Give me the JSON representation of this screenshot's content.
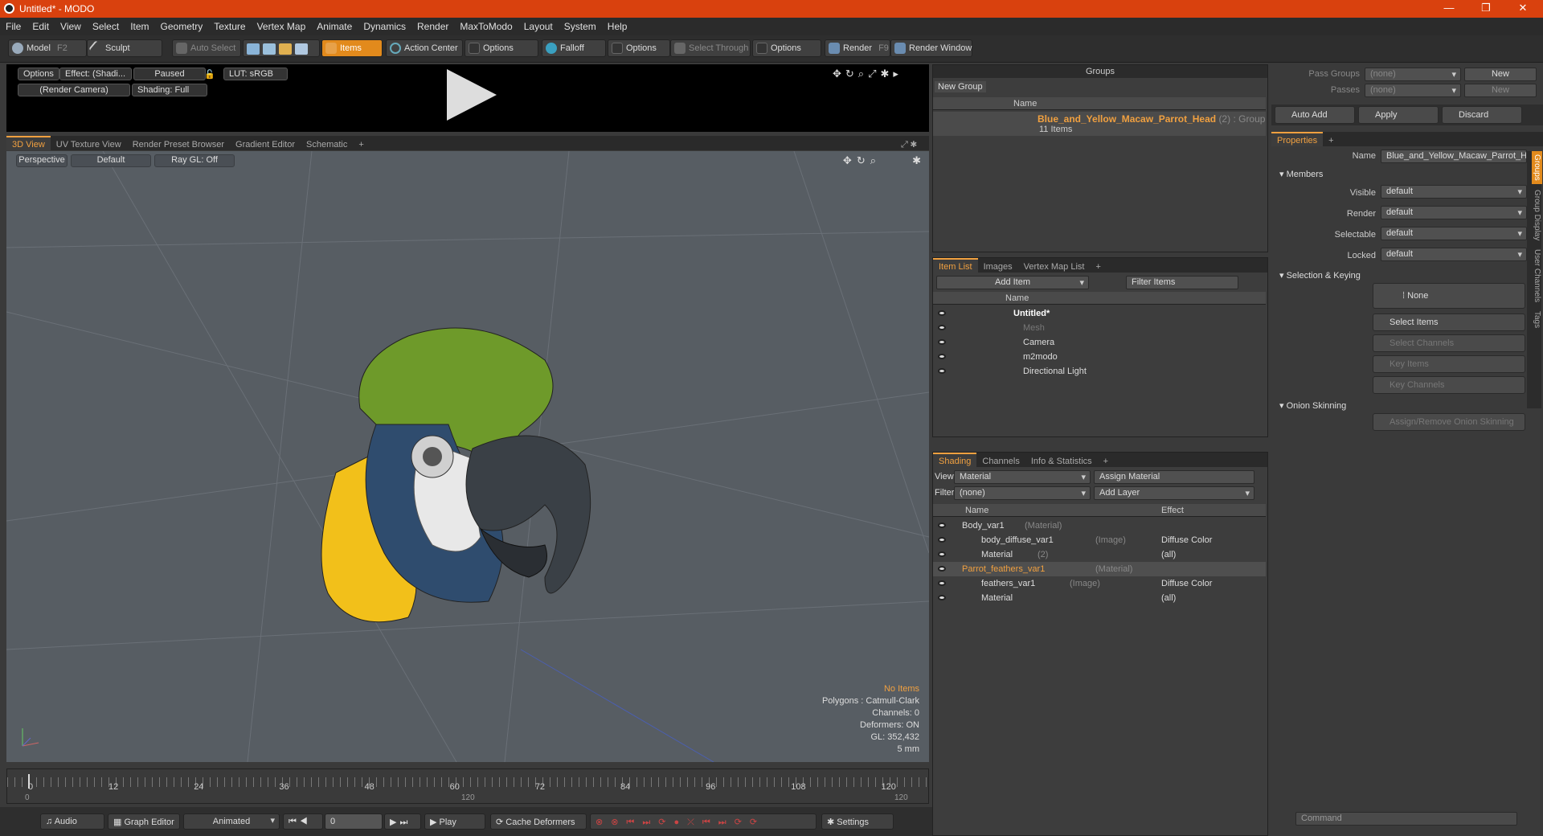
{
  "window": {
    "title": "Untitled* - MODO",
    "controls": [
      "—",
      "❐",
      "✕"
    ]
  },
  "menu": [
    "File",
    "Edit",
    "View",
    "Select",
    "Item",
    "Geometry",
    "Texture",
    "Vertex Map",
    "Animate",
    "Dynamics",
    "Render",
    "MaxToModo",
    "Layout",
    "System",
    "Help"
  ],
  "toolbar": {
    "model": "Model",
    "model_key": "F2",
    "sculpt": "Sculpt",
    "auto_select": "Auto Select",
    "items": "Items",
    "action_center": "Action Center",
    "options1": "Options",
    "falloff": "Falloff",
    "options2": "Options",
    "select_through": "Select Through",
    "options3": "Options",
    "render": "Render",
    "render_key": "F9",
    "render_window": "Render Window"
  },
  "preview": {
    "options": "Options",
    "effect": "Effect: (Shadi...",
    "paused": "Paused",
    "lut": "LUT: sRGB",
    "camera": "(Render Camera)",
    "shading": "Shading: Full"
  },
  "viewtabs": [
    "3D View",
    "UV Texture View",
    "Render Preset Browser",
    "Gradient Editor",
    "Schematic",
    "+"
  ],
  "viewport": {
    "projection": "Perspective",
    "style": "Default",
    "raygl": "Ray GL: Off"
  },
  "stats": {
    "no_items": "No Items",
    "polygons": "Polygons : Catmull-Clark",
    "channels": "Channels: 0",
    "deformers": "Deformers: ON",
    "gl": "GL: 352,432",
    "unit": "5 mm"
  },
  "timeline": {
    "ticks": [
      "0",
      "12",
      "24",
      "36",
      "48",
      "60",
      "72",
      "84",
      "96",
      "108",
      "120"
    ],
    "start": "0",
    "mid": "120",
    "end": "120"
  },
  "bottombar": {
    "audio": "Audio",
    "graph_editor": "Graph Editor",
    "animated": "Animated",
    "frame": "0",
    "play": "Play",
    "cache_deformers": "Cache Deformers",
    "settings": "Settings"
  },
  "groups": {
    "title": "Groups",
    "new_group": "New Group",
    "col_name": "Name",
    "group_name": "Blue_and_Yellow_Macaw_Parrot_Head",
    "group_suffix": "(2) : Group",
    "items_count": "11 Items"
  },
  "itemlist": {
    "tabs": [
      "Item List",
      "Images",
      "Vertex Map List",
      "+"
    ],
    "add_item": "Add Item",
    "filter": "Filter Items",
    "col_name": "Name",
    "items": [
      {
        "label": "Untitled*",
        "bold": true,
        "indent": 0
      },
      {
        "label": "Mesh",
        "dim": true,
        "indent": 1
      },
      {
        "label": "Camera",
        "indent": 1
      },
      {
        "label": "m2modo",
        "indent": 1
      },
      {
        "label": "Directional Light",
        "indent": 1
      }
    ]
  },
  "shading": {
    "tabs": [
      "Shading",
      "Channels",
      "Info & Statistics",
      "+"
    ],
    "view_label": "View",
    "view_value": "Material",
    "assign_material": "Assign Material",
    "filter_label": "Filter",
    "filter_value": "(none)",
    "add_layer": "Add Layer",
    "col_name": "Name",
    "col_effect": "Effect",
    "rows": [
      {
        "name": "Body_var1",
        "suffix": "(Material)",
        "effect": "",
        "level": 0,
        "type": "mat"
      },
      {
        "name": "body_diffuse_var1",
        "suffix": "(Image)",
        "effect": "Diffuse Color",
        "level": 1,
        "type": "img"
      },
      {
        "name": "Material",
        "suffix": "(2)",
        "effect": "(all)",
        "level": 1,
        "type": "base"
      },
      {
        "name": "Parrot_feathers_var1",
        "suffix": "(Material)",
        "effect": "",
        "level": 0,
        "type": "mat",
        "selected": true
      },
      {
        "name": "feathers_var1",
        "suffix": "(Image)",
        "effect": "Diffuse Color",
        "level": 1,
        "type": "img"
      },
      {
        "name": "Material",
        "suffix": "",
        "effect": "(all)",
        "level": 1,
        "type": "base"
      }
    ]
  },
  "passes": {
    "pass_groups": "Pass Groups",
    "passes": "Passes",
    "none1": "(none)",
    "none2": "(none)",
    "new1": "New",
    "new2": "New",
    "auto_add": "Auto Add",
    "apply": "Apply",
    "discard": "Discard"
  },
  "properties": {
    "tab": "Properties",
    "name_label": "Name",
    "name_value": "Blue_and_Yellow_Macaw_Parrot_He",
    "members": "Members",
    "visible": "Visible",
    "render": "Render",
    "selectable": "Selectable",
    "locked": "Locked",
    "default": "default",
    "selection_keying": "Selection & Keying",
    "none": "None",
    "select_items": "Select Items",
    "select_channels": "Select Channels",
    "key_items": "Key Items",
    "key_channels": "Key Channels",
    "onion": "Onion Skinning",
    "assign_onion": "Assign/Remove Onion Skinning",
    "sidetabs": [
      "Groups",
      "Group Display",
      "User Channels",
      "Tags"
    ]
  },
  "command": {
    "placeholder": "Command"
  },
  "colors": {
    "accent": "#f0a040",
    "title": "#d9410e"
  }
}
